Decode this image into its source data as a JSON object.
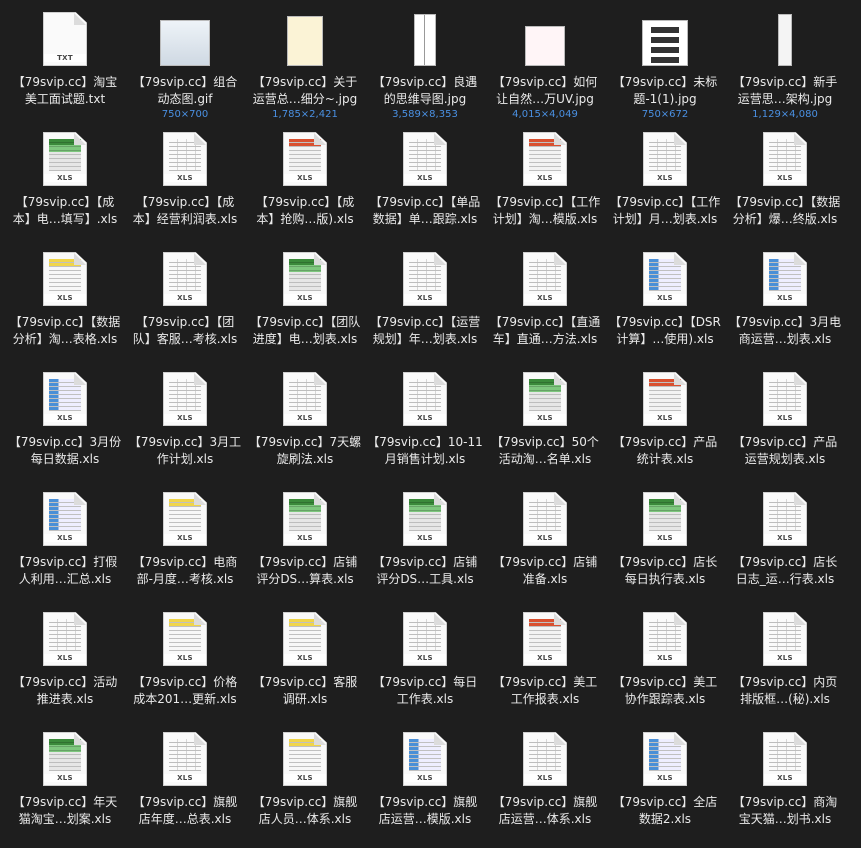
{
  "files": [
    {
      "line1": "【79svip.cc】淘宝",
      "line2": "美工面试题.txt",
      "dims": "",
      "kind": "txt",
      "badge": "TXT"
    },
    {
      "line1": "【79svip.cc】组合",
      "line2": "动态图.gif",
      "dims": "750×700",
      "kind": "img-gif",
      "badge": ""
    },
    {
      "line1": "【79svip.cc】关于",
      "line2": "运营总…细分~.jpg",
      "dims": "1,785×2,421",
      "kind": "img-yel",
      "badge": ""
    },
    {
      "line1": "【79svip.cc】良遇",
      "line2": "的思维导图.jpg",
      "dims": "3,589×8,353",
      "kind": "img-line",
      "badge": ""
    },
    {
      "line1": "【79svip.cc】如何",
      "line2": "让自然…万UV.jpg",
      "dims": "4,015×4,049",
      "kind": "img-mind",
      "badge": ""
    },
    {
      "line1": "【79svip.cc】未标",
      "line2": "题-1(1).jpg",
      "dims": "750×672",
      "kind": "img-shelf",
      "badge": ""
    },
    {
      "line1": "【79svip.cc】新手",
      "line2": "运营思…架构.jpg",
      "dims": "1,129×4,080",
      "kind": "img-tall",
      "badge": ""
    },
    {
      "line1": "【79svip.cc】【成",
      "line2": "本】电…填写】.xls",
      "dims": "",
      "kind": "color",
      "badge": "XLS"
    },
    {
      "line1": "【79svip.cc】【成",
      "line2": "本】经营利润表.xls",
      "dims": "",
      "kind": "plain",
      "badge": "XLS"
    },
    {
      "line1": "【79svip.cc】【成",
      "line2": "本】抢购…版).xls",
      "dims": "",
      "kind": "redhdr",
      "badge": "XLS"
    },
    {
      "line1": "【79svip.cc】【单品",
      "line2": "数据】单…跟踪.xls",
      "dims": "",
      "kind": "plain",
      "badge": "XLS"
    },
    {
      "line1": "【79svip.cc】【工作",
      "line2": "计划】淘…模版.xls",
      "dims": "",
      "kind": "redhdr",
      "badge": "XLS"
    },
    {
      "line1": "【79svip.cc】【工作",
      "line2": "计划】月…划表.xls",
      "dims": "",
      "kind": "plain",
      "badge": "XLS"
    },
    {
      "line1": "【79svip.cc】【数据",
      "line2": "分析】爆…终版.xls",
      "dims": "",
      "kind": "plain",
      "badge": "XLS"
    },
    {
      "line1": "【79svip.cc】【数据",
      "line2": "分析】淘…表格.xls",
      "dims": "",
      "kind": "yellow",
      "badge": "XLS"
    },
    {
      "line1": "【79svip.cc】【团",
      "line2": "队】客服…考核.xls",
      "dims": "",
      "kind": "plain",
      "badge": "XLS"
    },
    {
      "line1": "【79svip.cc】【团队",
      "line2": "进度】电…划表.xls",
      "dims": "",
      "kind": "color",
      "badge": "XLS"
    },
    {
      "line1": "【79svip.cc】【运营",
      "line2": "规划】年…划表.xls",
      "dims": "",
      "kind": "plain",
      "badge": "XLS"
    },
    {
      "line1": "【79svip.cc】【直通",
      "line2": "车】直通…方法.xls",
      "dims": "",
      "kind": "plain",
      "badge": "XLS"
    },
    {
      "line1": "【79svip.cc】【DSR",
      "line2": "计算】…使用).xls",
      "dims": "",
      "kind": "blue",
      "badge": "XLS"
    },
    {
      "line1": "【79svip.cc】3月电",
      "line2": "商运营…划表.xls",
      "dims": "",
      "kind": "blue",
      "badge": "XLS"
    },
    {
      "line1": "【79svip.cc】3月份",
      "line2": "每日数据.xls",
      "dims": "",
      "kind": "blue",
      "badge": "XLS"
    },
    {
      "line1": "【79svip.cc】3月工",
      "line2": "作计划.xls",
      "dims": "",
      "kind": "plain",
      "badge": "XLS"
    },
    {
      "line1": "【79svip.cc】7天螺",
      "line2": "旋刷法.xls",
      "dims": "",
      "kind": "plain",
      "badge": "XLS"
    },
    {
      "line1": "【79svip.cc】10-11",
      "line2": "月销售计划.xls",
      "dims": "",
      "kind": "plain",
      "badge": "XLS"
    },
    {
      "line1": "【79svip.cc】50个",
      "line2": "活动淘…名单.xls",
      "dims": "",
      "kind": "color",
      "badge": "XLS"
    },
    {
      "line1": "【79svip.cc】产品",
      "line2": "统计表.xls",
      "dims": "",
      "kind": "redhdr",
      "badge": "XLS"
    },
    {
      "line1": "【79svip.cc】产品",
      "line2": "运营规划表.xls",
      "dims": "",
      "kind": "plain",
      "badge": "XLS"
    },
    {
      "line1": "【79svip.cc】打假",
      "line2": "人利用…汇总.xls",
      "dims": "",
      "kind": "blue",
      "badge": "XLS"
    },
    {
      "line1": "【79svip.cc】电商",
      "line2": "部-月度…考核.xls",
      "dims": "",
      "kind": "yellow",
      "badge": "XLS"
    },
    {
      "line1": "【79svip.cc】店铺",
      "line2": "评分DS…算表.xls",
      "dims": "",
      "kind": "color",
      "badge": "XLS"
    },
    {
      "line1": "【79svip.cc】店铺",
      "line2": "评分DS…工具.xls",
      "dims": "",
      "kind": "color",
      "badge": "XLS"
    },
    {
      "line1": "【79svip.cc】店铺",
      "line2": "准备.xls",
      "dims": "",
      "kind": "plain",
      "badge": "XLS"
    },
    {
      "line1": "【79svip.cc】店长",
      "line2": "每日执行表.xls",
      "dims": "",
      "kind": "color",
      "badge": "XLS"
    },
    {
      "line1": "【79svip.cc】店长",
      "line2": "日志_运…行表.xls",
      "dims": "",
      "kind": "plain",
      "badge": "XLS"
    },
    {
      "line1": "【79svip.cc】活动",
      "line2": "推进表.xls",
      "dims": "",
      "kind": "plain",
      "badge": "XLS"
    },
    {
      "line1": "【79svip.cc】价格",
      "line2": "成本201…更新.xls",
      "dims": "",
      "kind": "yellow",
      "badge": "XLS"
    },
    {
      "line1": "【79svip.cc】客服",
      "line2": "调研.xls",
      "dims": "",
      "kind": "yellow",
      "badge": "XLS"
    },
    {
      "line1": "【79svip.cc】每日",
      "line2": "工作表.xls",
      "dims": "",
      "kind": "plain",
      "badge": "XLS"
    },
    {
      "line1": "【79svip.cc】美工",
      "line2": "工作报表.xls",
      "dims": "",
      "kind": "redhdr",
      "badge": "XLS"
    },
    {
      "line1": "【79svip.cc】美工",
      "line2": "协作跟踪表.xls",
      "dims": "",
      "kind": "plain",
      "badge": "XLS"
    },
    {
      "line1": "【79svip.cc】内页",
      "line2": "排版框…(秘).xls",
      "dims": "",
      "kind": "plain",
      "badge": "XLS"
    },
    {
      "line1": "【79svip.cc】年天",
      "line2": "猫淘宝…划案.xls",
      "dims": "",
      "kind": "color",
      "badge": "XLS"
    },
    {
      "line1": "【79svip.cc】旗舰",
      "line2": "店年度…总表.xls",
      "dims": "",
      "kind": "plain",
      "badge": "XLS"
    },
    {
      "line1": "【79svip.cc】旗舰",
      "line2": "店人员…体系.xls",
      "dims": "",
      "kind": "yellow",
      "badge": "XLS"
    },
    {
      "line1": "【79svip.cc】旗舰",
      "line2": "店运营…模版.xls",
      "dims": "",
      "kind": "blue",
      "badge": "XLS"
    },
    {
      "line1": "【79svip.cc】旗舰",
      "line2": "店运营…体系.xls",
      "dims": "",
      "kind": "plain",
      "badge": "XLS"
    },
    {
      "line1": "【79svip.cc】全店",
      "line2": "数据2.xls",
      "dims": "",
      "kind": "blue",
      "badge": "XLS"
    },
    {
      "line1": "【79svip.cc】商淘",
      "line2": "宝天猫…划书.xls",
      "dims": "",
      "kind": "plain",
      "badge": "XLS"
    }
  ],
  "icon_names": {
    "txt": "text-file-icon",
    "xls": "spreadsheet-file-icon",
    "img": "image-thumbnail-icon"
  },
  "colors": {
    "background": "#1e1e1e",
    "label": "#eaeaea",
    "dims": "#4a90e2"
  }
}
